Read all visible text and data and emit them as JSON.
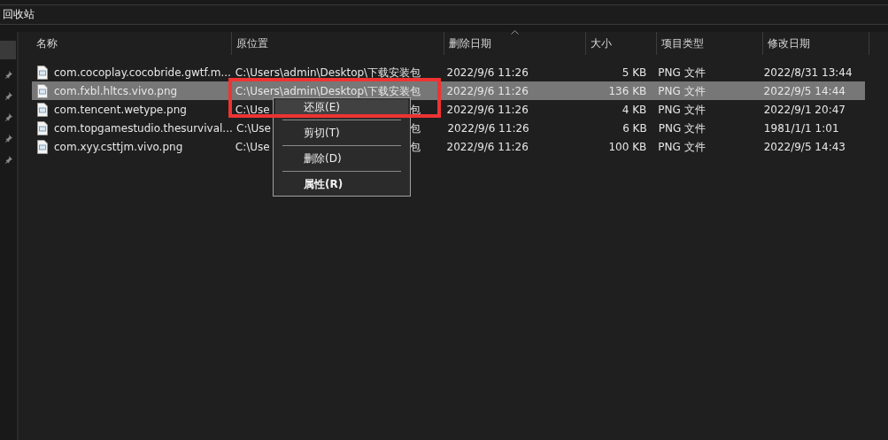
{
  "window": {
    "title": "回收站"
  },
  "sidebar": {
    "items": [
      {
        "kind": "block",
        "selected": true
      },
      {
        "kind": "pin"
      },
      {
        "kind": "pin"
      },
      {
        "kind": "pin"
      },
      {
        "kind": "pin"
      },
      {
        "kind": "pin"
      }
    ]
  },
  "table": {
    "columns": [
      {
        "label": "名称",
        "sorted": false
      },
      {
        "label": "原位置",
        "sorted": false
      },
      {
        "label": "删除日期",
        "sorted": true
      },
      {
        "label": "大小",
        "sorted": false
      },
      {
        "label": "项目类型",
        "sorted": false
      },
      {
        "label": "修改日期",
        "sorted": false
      }
    ],
    "rows": [
      {
        "selected": false,
        "cells": [
          "com.cocoplay.cocobride.gwtf.m...",
          "C:\\Users\\admin\\Desktop\\下载安装包",
          "2022/9/6 11:26",
          "5 KB",
          "PNG 文件",
          "2022/8/31 13:44"
        ]
      },
      {
        "selected": true,
        "cells": [
          "com.fxbl.hltcs.vivo.png",
          "C:\\Users\\admin\\Desktop\\下载安装包",
          "2022/9/6 11:26",
          "136 KB",
          "PNG 文件",
          "2022/9/5 14:44"
        ]
      },
      {
        "selected": false,
        "cells": [
          "com.tencent.wetype.png",
          "C:\\Use",
          "2022/9/6 11:26",
          "4 KB",
          "PNG 文件",
          "2022/9/1 20:47"
        ],
        "location_tail": "包"
      },
      {
        "selected": false,
        "cells": [
          "com.topgamestudio.thesurvival...",
          "C:\\Use",
          "2022/9/6 11:26",
          "6 KB",
          "PNG 文件",
          "1981/1/1 1:01"
        ],
        "location_tail": "包"
      },
      {
        "selected": false,
        "cells": [
          "com.xyy.csttjm.vivo.png",
          "C:\\Use",
          "2022/9/6 11:26",
          "100 KB",
          "PNG 文件",
          "2022/9/5 14:43"
        ],
        "location_tail": "包"
      }
    ]
  },
  "context_menu": {
    "items": [
      {
        "label": "还原(E)",
        "selected": true,
        "bold": false
      },
      {
        "label": "剪切(T)",
        "selected": false,
        "bold": false
      },
      {
        "label": "删除(D)",
        "selected": false,
        "bold": false
      },
      {
        "label": "属性(R)",
        "selected": false,
        "bold": true
      }
    ]
  }
}
